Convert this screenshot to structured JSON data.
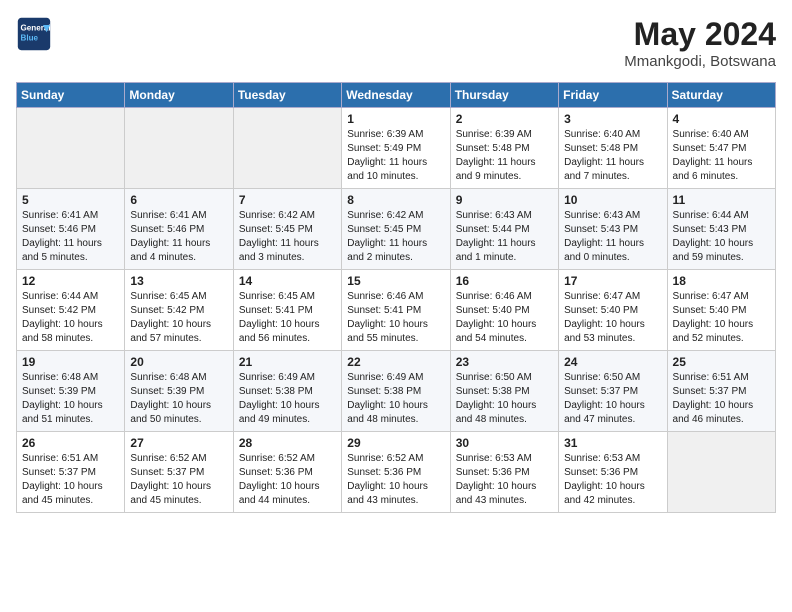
{
  "header": {
    "logo_line1": "General",
    "logo_line2": "Blue",
    "month": "May 2024",
    "location": "Mmankgodi, Botswana"
  },
  "days_of_week": [
    "Sunday",
    "Monday",
    "Tuesday",
    "Wednesday",
    "Thursday",
    "Friday",
    "Saturday"
  ],
  "weeks": [
    [
      {
        "num": "",
        "info": "",
        "empty": true
      },
      {
        "num": "",
        "info": "",
        "empty": true
      },
      {
        "num": "",
        "info": "",
        "empty": true
      },
      {
        "num": "1",
        "info": "Sunrise: 6:39 AM\nSunset: 5:49 PM\nDaylight: 11 hours\nand 10 minutes."
      },
      {
        "num": "2",
        "info": "Sunrise: 6:39 AM\nSunset: 5:48 PM\nDaylight: 11 hours\nand 9 minutes."
      },
      {
        "num": "3",
        "info": "Sunrise: 6:40 AM\nSunset: 5:48 PM\nDaylight: 11 hours\nand 7 minutes."
      },
      {
        "num": "4",
        "info": "Sunrise: 6:40 AM\nSunset: 5:47 PM\nDaylight: 11 hours\nand 6 minutes."
      }
    ],
    [
      {
        "num": "5",
        "info": "Sunrise: 6:41 AM\nSunset: 5:46 PM\nDaylight: 11 hours\nand 5 minutes."
      },
      {
        "num": "6",
        "info": "Sunrise: 6:41 AM\nSunset: 5:46 PM\nDaylight: 11 hours\nand 4 minutes."
      },
      {
        "num": "7",
        "info": "Sunrise: 6:42 AM\nSunset: 5:45 PM\nDaylight: 11 hours\nand 3 minutes."
      },
      {
        "num": "8",
        "info": "Sunrise: 6:42 AM\nSunset: 5:45 PM\nDaylight: 11 hours\nand 2 minutes."
      },
      {
        "num": "9",
        "info": "Sunrise: 6:43 AM\nSunset: 5:44 PM\nDaylight: 11 hours\nand 1 minute."
      },
      {
        "num": "10",
        "info": "Sunrise: 6:43 AM\nSunset: 5:43 PM\nDaylight: 11 hours\nand 0 minutes."
      },
      {
        "num": "11",
        "info": "Sunrise: 6:44 AM\nSunset: 5:43 PM\nDaylight: 10 hours\nand 59 minutes."
      }
    ],
    [
      {
        "num": "12",
        "info": "Sunrise: 6:44 AM\nSunset: 5:42 PM\nDaylight: 10 hours\nand 58 minutes."
      },
      {
        "num": "13",
        "info": "Sunrise: 6:45 AM\nSunset: 5:42 PM\nDaylight: 10 hours\nand 57 minutes."
      },
      {
        "num": "14",
        "info": "Sunrise: 6:45 AM\nSunset: 5:41 PM\nDaylight: 10 hours\nand 56 minutes."
      },
      {
        "num": "15",
        "info": "Sunrise: 6:46 AM\nSunset: 5:41 PM\nDaylight: 10 hours\nand 55 minutes."
      },
      {
        "num": "16",
        "info": "Sunrise: 6:46 AM\nSunset: 5:40 PM\nDaylight: 10 hours\nand 54 minutes."
      },
      {
        "num": "17",
        "info": "Sunrise: 6:47 AM\nSunset: 5:40 PM\nDaylight: 10 hours\nand 53 minutes."
      },
      {
        "num": "18",
        "info": "Sunrise: 6:47 AM\nSunset: 5:40 PM\nDaylight: 10 hours\nand 52 minutes."
      }
    ],
    [
      {
        "num": "19",
        "info": "Sunrise: 6:48 AM\nSunset: 5:39 PM\nDaylight: 10 hours\nand 51 minutes."
      },
      {
        "num": "20",
        "info": "Sunrise: 6:48 AM\nSunset: 5:39 PM\nDaylight: 10 hours\nand 50 minutes."
      },
      {
        "num": "21",
        "info": "Sunrise: 6:49 AM\nSunset: 5:38 PM\nDaylight: 10 hours\nand 49 minutes."
      },
      {
        "num": "22",
        "info": "Sunrise: 6:49 AM\nSunset: 5:38 PM\nDaylight: 10 hours\nand 48 minutes."
      },
      {
        "num": "23",
        "info": "Sunrise: 6:50 AM\nSunset: 5:38 PM\nDaylight: 10 hours\nand 48 minutes."
      },
      {
        "num": "24",
        "info": "Sunrise: 6:50 AM\nSunset: 5:37 PM\nDaylight: 10 hours\nand 47 minutes."
      },
      {
        "num": "25",
        "info": "Sunrise: 6:51 AM\nSunset: 5:37 PM\nDaylight: 10 hours\nand 46 minutes."
      }
    ],
    [
      {
        "num": "26",
        "info": "Sunrise: 6:51 AM\nSunset: 5:37 PM\nDaylight: 10 hours\nand 45 minutes."
      },
      {
        "num": "27",
        "info": "Sunrise: 6:52 AM\nSunset: 5:37 PM\nDaylight: 10 hours\nand 45 minutes."
      },
      {
        "num": "28",
        "info": "Sunrise: 6:52 AM\nSunset: 5:36 PM\nDaylight: 10 hours\nand 44 minutes."
      },
      {
        "num": "29",
        "info": "Sunrise: 6:52 AM\nSunset: 5:36 PM\nDaylight: 10 hours\nand 43 minutes."
      },
      {
        "num": "30",
        "info": "Sunrise: 6:53 AM\nSunset: 5:36 PM\nDaylight: 10 hours\nand 43 minutes."
      },
      {
        "num": "31",
        "info": "Sunrise: 6:53 AM\nSunset: 5:36 PM\nDaylight: 10 hours\nand 42 minutes."
      },
      {
        "num": "",
        "info": "",
        "empty": true
      }
    ]
  ]
}
